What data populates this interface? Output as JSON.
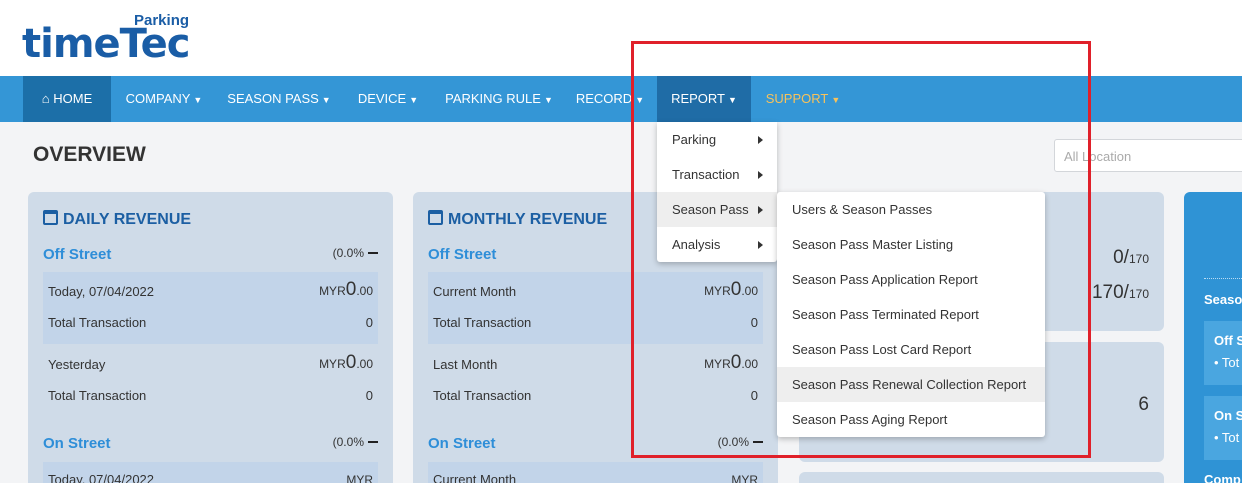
{
  "logo": {
    "main": "timeTec",
    "sub": "Parking"
  },
  "nav": {
    "home": "HOME",
    "company": "COMPANY",
    "season_pass": "SEASON PASS",
    "device": "DEVICE",
    "parking_rule": "PARKING RULE",
    "record": "RECORD",
    "report": "REPORT",
    "support": "SUPPORT"
  },
  "page_title": "OVERVIEW",
  "location_placeholder": "All Location",
  "daily": {
    "title": "DAILY REVENUE",
    "off_street": "Off Street",
    "off_pct": "(0.0%",
    "today_label": "Today, 07/04/2022",
    "today_cur": "MYR",
    "today_int": "0",
    "today_dec": ".00",
    "tt_label": "Total Transaction",
    "tt_val": "0",
    "yest_label": "Yesterday",
    "yest_cur": "MYR",
    "yest_int": "0",
    "yest_dec": ".00",
    "tt2_label": "Total Transaction",
    "tt2_val": "0",
    "on_street": "On Street",
    "on_pct": "(0.0%",
    "today2_label": "Today, 07/04/2022",
    "today2_cur": "MYR"
  },
  "monthly": {
    "title": "MONTHLY REVENUE",
    "off_street": "Off Street",
    "cm_label": "Current Month",
    "cm_cur": "MYR",
    "cm_int": "0",
    "cm_dec": ".00",
    "tt_label": "Total Transaction",
    "tt_val": "0",
    "lm_label": "Last Month",
    "lm_cur": "MYR",
    "lm_int": "0",
    "lm_dec": ".00",
    "tt2_label": "Total Transaction",
    "tt2_val": "0",
    "on_street": "On Street",
    "on_pct": "(0.0%",
    "cm2_label": "Current Month",
    "cm2_cur": "MYR"
  },
  "stats": {
    "a_num": "0/",
    "a_den": "170",
    "b_num": "170/",
    "b_den": "170",
    "c": "6"
  },
  "side": {
    "season": "Seaso",
    "off": "Off S",
    "off_tot": "• Tot",
    "on": "On S",
    "on_tot": "• Tot",
    "comp": "Comp"
  },
  "report_menu": [
    "Parking",
    "Transaction",
    "Season Pass",
    "Analysis"
  ],
  "season_pass_menu": [
    "Users & Season Passes",
    "Season Pass Master Listing",
    "Season Pass Application Report",
    "Season Pass Terminated Report",
    "Season Pass Lost Card Report",
    "Season Pass Renewal Collection Report",
    "Season Pass Aging Report"
  ],
  "colors": {
    "nav": "#3496d6",
    "nav_active": "#1f6ca6",
    "support": "#f7c25b",
    "panel": "#cfdbe8",
    "highlight_box": "#e0202a"
  }
}
